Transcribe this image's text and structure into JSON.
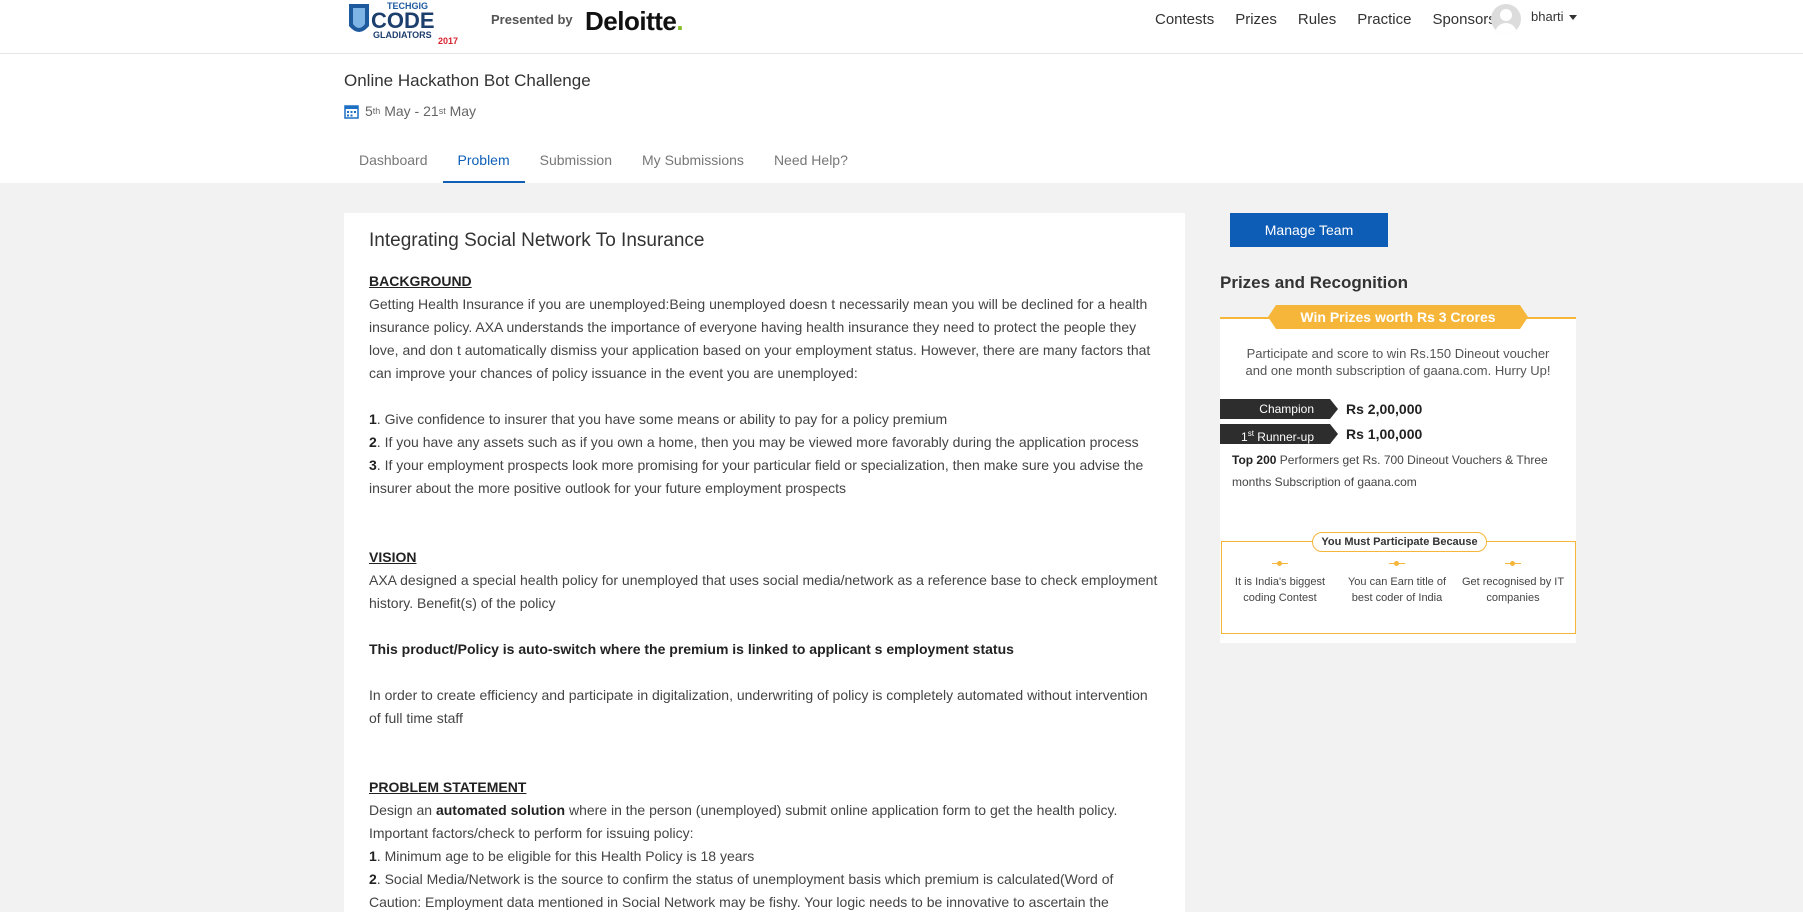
{
  "header": {
    "logo_top": "TECHGIG",
    "logo_main": "CODE",
    "logo_sub": "GLADIATORS",
    "logo_year": "2017",
    "presented_by": "Presented by",
    "sponsor_brand": "Deloitte",
    "sponsor_dot": ".",
    "nav": [
      "Contests",
      "Prizes",
      "Rules",
      "Practice",
      "Sponsors"
    ],
    "username": "bharti"
  },
  "contest": {
    "title": "Online Hackathon Bot Challenge",
    "date_start": "5",
    "date_start_sup": "th",
    "date_start_month": "May",
    "date_sep": " - ",
    "date_end": "21",
    "date_end_sup": "st",
    "date_end_month": "May",
    "tabs": [
      "Dashboard",
      "Problem",
      "Submission",
      "My Submissions",
      "Need Help?"
    ],
    "active_tab": "Problem"
  },
  "problem": {
    "title": "Integrating Social Network To Insurance",
    "background_head": "BACKGROUND",
    "background_text": "Getting Health Insurance if you are unemployed:Being unemployed doesn t necessarily mean you will be declined for a health insurance policy. AXA understands the importance of everyone having health insurance they need to protect the people they love, and don t automatically dismiss your application based on your employment status. However, there are many factors that can improve your chances of policy issuance in the event you are unemployed:",
    "factors": [
      {
        "num": "1",
        "text": ". Give confidence to insurer that you have some means or ability to pay for a policy premium"
      },
      {
        "num": "2",
        "text": ". If you have any assets such as if you own a home, then you may be viewed more favorably during the application process"
      },
      {
        "num": "3",
        "text": ". If your employment prospects look more promising for your particular field or specialization, then make sure you advise the insurer about the more positive outlook for your future employment prospects"
      }
    ],
    "vision_head": "VISION",
    "vision_text": "AXA designed a special health policy for unemployed that uses social media/network as a reference base to check employment history. Benefit(s) of the policy",
    "vision_bold": "This product/Policy is auto-switch where the premium is linked to applicant s employment status",
    "vision_text2": "In order to create efficiency and participate in digitalization, underwriting of policy is completely automated without intervention of full time staff",
    "statement_head": "PROBLEM STATEMENT",
    "statement_pre": "Design an ",
    "statement_bold": "automated solution",
    "statement_post": " where in the person (unemployed) submit online application form to get the health policy.",
    "statement_line2": "Important factors/check to perform for issuing policy:",
    "checks": [
      {
        "num": "1",
        "text": ". Minimum age to be eligible for this Health Policy is 18 years"
      },
      {
        "num": "2",
        "text": ". Social Media/Network is the source to confirm the status of unemployment basis which premium is calculated(Word of Caution: Employment data mentioned in Social Network may be fishy. Your logic needs to be innovative to ascertain the"
      }
    ]
  },
  "sidebar": {
    "manage_team": "Manage Team",
    "prizes_head": "Prizes and Recognition",
    "ribbon": "Win Prizes worth Rs 3 Crores",
    "prize_desc": "Participate and score to win Rs.150 Dineout voucher and one month subscription of gaana.com. Hurry Up!",
    "champion_label": "Champion",
    "champion_amount": "Rs 2,00,000",
    "runnerup_num": "1",
    "runnerup_sup": "st",
    "runnerup_label": " Runner-up",
    "runnerup_amount": "Rs 1,00,000",
    "top200_bold": "Top 200",
    "top200_text": " Performers get Rs. 700 Dineout Vouchers & Three months Subscription of gaana.com",
    "reasons_head": "You Must Participate Because",
    "reasons": [
      "It is India's biggest coding Contest",
      "You can Earn title of best coder of India",
      "Get recognised by IT companies"
    ]
  },
  "colors": {
    "accent_blue": "#1060b8",
    "button_blue": "#0d5cb6",
    "gold": "#f5b63a",
    "deloitte_green": "#86bc25"
  }
}
